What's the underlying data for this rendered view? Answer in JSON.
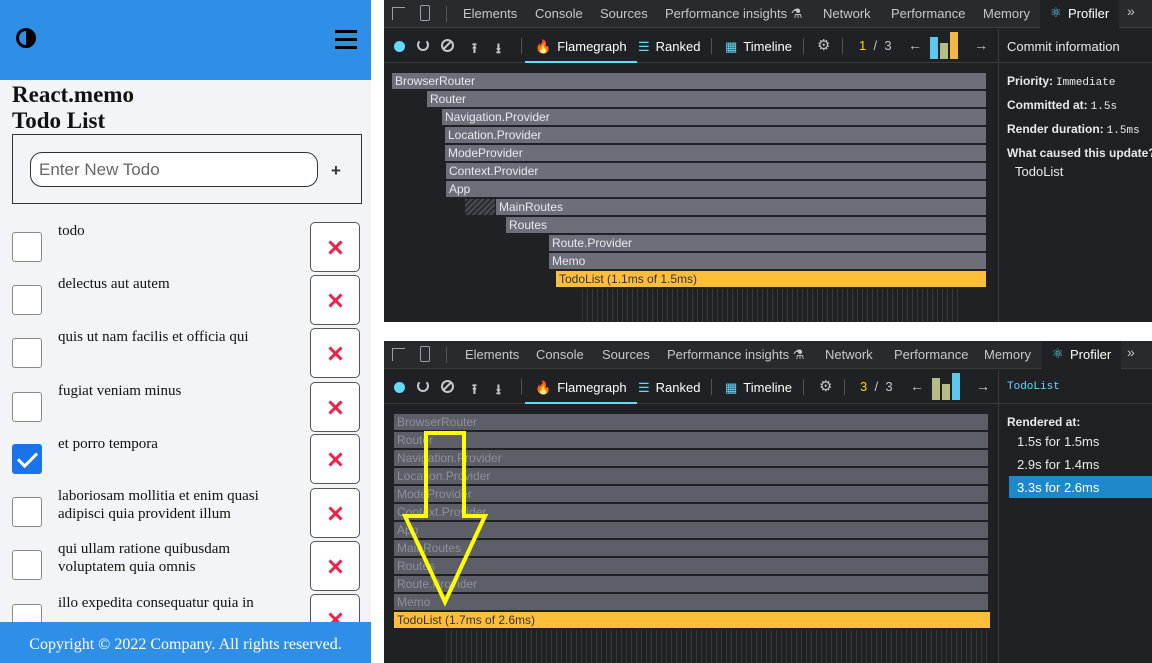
{
  "app": {
    "title_line1": "React.memo",
    "title_line2": "Todo List",
    "input_placeholder": "Enter New Todo",
    "add_label": "+",
    "todos": [
      {
        "text": "todo",
        "checked": false
      },
      {
        "text": "delectus aut autem",
        "checked": false
      },
      {
        "text": "quis ut nam facilis et officia qui",
        "checked": false
      },
      {
        "text": "fugiat veniam minus",
        "checked": false
      },
      {
        "text": "et porro tempora",
        "checked": true
      },
      {
        "text": "laboriosam mollitia et enim quasi adipisci quia provident illum",
        "checked": false
      },
      {
        "text": "qui ullam ratione quibusdam voluptatem quia omnis",
        "checked": false
      },
      {
        "text": "illo expedita consequatur quia in",
        "checked": false
      }
    ],
    "footer": "Copyright © 2022 Company. All rights reserved.",
    "accent_color": "#2f8fe6",
    "delete_color": "#e8254d"
  },
  "devtools_tabs": [
    "Elements",
    "Console",
    "Sources",
    "Performance insights ⚗",
    "Network",
    "Performance",
    "Memory",
    "Profiler"
  ],
  "toolbar": {
    "flamegraph": "Flamegraph",
    "ranked": "Ranked",
    "timeline": "Timeline",
    "total_commits": "3",
    "separator": "/"
  },
  "top_panel": {
    "current_commit": "1",
    "commit_bar_heights": [
      0.8,
      0.55,
      1.0
    ],
    "commit_info_title": "Commit information",
    "priority_label": "Priority:",
    "priority_value": "Immediate",
    "committed_label": "Committed at:",
    "committed_value": "1.5s",
    "duration_label": "Render duration:",
    "duration_value": "1.5ms",
    "cause_label": "What caused this update?",
    "cause_value": "TodoList",
    "flamegraph": [
      "BrowserRouter",
      "Router",
      "Navigation.Provider",
      "Location.Provider",
      "ModeProvider",
      "Context.Provider",
      "App",
      "MainRoutes",
      "Routes",
      "Route.Provider",
      "Memo",
      "TodoList (1.1ms of 1.5ms)"
    ]
  },
  "bottom_panel": {
    "current_commit": "3",
    "commit_bar_heights": [
      0.8,
      0.55,
      1.0
    ],
    "component_title": "TodoList",
    "rendered_label": "Rendered at:",
    "renders": [
      "1.5s for 1.5ms",
      "2.9s for 1.4ms",
      "3.3s for 2.6ms"
    ],
    "selected_render": 2,
    "flamegraph": [
      "BrowserRouter",
      "Router",
      "Navigation.Provider",
      "Location.Provider",
      "ModeProvider",
      "Context.Provider",
      "App",
      "MainRoutes",
      "Routes",
      "Route.Provider",
      "Memo",
      "TodoList (1.7ms of 2.6ms)"
    ]
  },
  "colors": {
    "highlight": "#ffbe3a",
    "selection": "#1d89c8",
    "react_blue": "#61dafb",
    "annotation": "#ffff00"
  }
}
